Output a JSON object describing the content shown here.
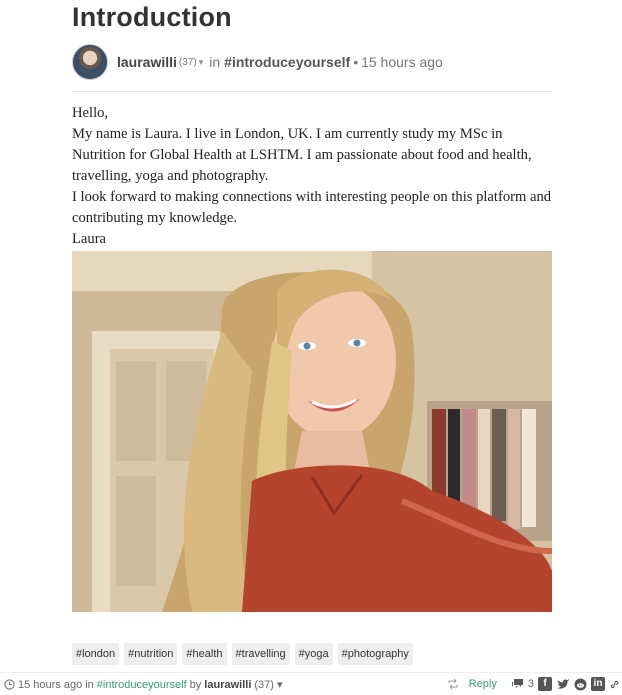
{
  "post": {
    "title": "Introduction",
    "author": "laurawilli",
    "reputation": "(37)",
    "in_label": "in",
    "community": "#introduceyourself",
    "separator": "•",
    "time": "15 hours ago",
    "paragraphs": [
      "Hello,",
      "My name is Laura. I live in London, UK. I am currently study my MSc in Nutrition for Global Health at LSHTM. I am passionate about food and health, travelling, yoga and photography.",
      "I look forward to making connections with interesting people on this platform and contributing my knowledge.",
      "Laura"
    ]
  },
  "tags": [
    "#london",
    "#nutrition",
    "#health",
    "#travelling",
    "#yoga",
    "#photography"
  ],
  "footer": {
    "time": "15 hours ago",
    "in_label": "in",
    "community": "#introduceyourself",
    "by_label": "by",
    "author": "laurawilli",
    "reputation": "(37)",
    "reply_label": "Reply",
    "comment_count": "3"
  },
  "icons": {
    "footer_clock": "clock-icon",
    "reblog": "reblog-icon",
    "comments": "comments-icon",
    "facebook": "facebook-icon",
    "twitter": "twitter-icon",
    "reddit": "reddit-icon",
    "linkedin": "linkedin-icon",
    "link": "link-icon"
  },
  "colors": {
    "accent": "#3a9a7a",
    "tag_bg": "#eeeeee"
  }
}
